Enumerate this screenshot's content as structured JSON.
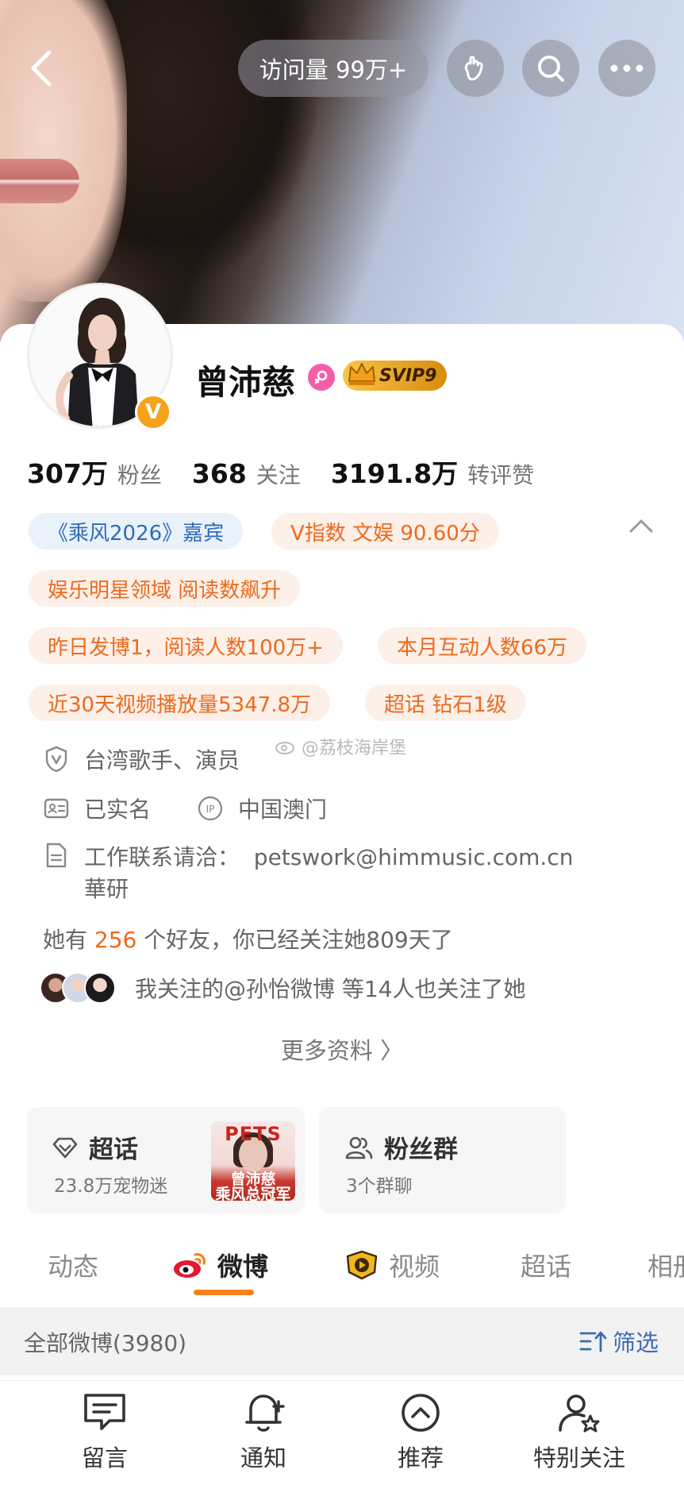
{
  "header": {
    "visit_label": "访问量 99万+"
  },
  "profile": {
    "name": "曾沛慈",
    "verified_badge": "V",
    "vip_label": "SVIP9"
  },
  "stats": [
    {
      "value": "307万",
      "label": "粉丝"
    },
    {
      "value": "368",
      "label": "关注"
    },
    {
      "value": "3191.8万",
      "label": "转评赞"
    }
  ],
  "tags": [
    {
      "text": "《乘风2026》嘉宾",
      "style": "blue"
    },
    {
      "text": "V指数 文娱 90.60分",
      "style": "orange"
    },
    {
      "text": "娱乐明星领域 阅读数飙升",
      "style": "orange"
    },
    {
      "text": "昨日发博1，阅读人数100万+",
      "style": "orange"
    },
    {
      "text": "本月互动人数66万",
      "style": "orange"
    },
    {
      "text": "近30天视频播放量5347.8万",
      "style": "orange"
    },
    {
      "text": "超话 钻石1级",
      "style": "orange"
    }
  ],
  "info": {
    "occupation": "台湾歌手、演员",
    "real_name": "已实名",
    "ip_location": "中国澳门",
    "contact_line1": "工作联系请洽：  petswork@himmusic.com.cn",
    "contact_line2": "華研",
    "friends_prefix": "她有 ",
    "friends_count": "256",
    "friends_suffix": " 个好友，你已经关注她809天了",
    "mutual_text": "我关注的@孙怡微博 等14人也关注了她",
    "more_info": "更多资料 〉"
  },
  "watermark": "@荔枝海岸堡",
  "features": {
    "chaohua": {
      "title": "超话",
      "subtitle": "23.8万宠物迷",
      "poster_top": "PETS",
      "poster_text_1": "曾沛慈",
      "poster_text_2": "乘风总冠军"
    },
    "fan_group": {
      "title": "粉丝群",
      "subtitle": "3个群聊"
    }
  },
  "tabs": [
    {
      "label": "动态",
      "active": false
    },
    {
      "label": "微博",
      "active": true
    },
    {
      "label": "视频",
      "active": false
    },
    {
      "label": "超话",
      "active": false
    },
    {
      "label": "相册",
      "active": false
    }
  ],
  "filter_bar": {
    "all_label": "全部微博(3980)",
    "filter_label": "筛选"
  },
  "bottom_bar": [
    {
      "label": "留言",
      "icon": "message-icon"
    },
    {
      "label": "通知",
      "icon": "bell-plus-icon"
    },
    {
      "label": "推荐",
      "icon": "chevron-up-circle-icon"
    },
    {
      "label": "特别关注",
      "icon": "user-star-icon"
    }
  ],
  "colors": {
    "accent_orange": "#ec6a1e",
    "tag_blue": "#2f6cb5",
    "weibo_orange": "#f7821b"
  }
}
